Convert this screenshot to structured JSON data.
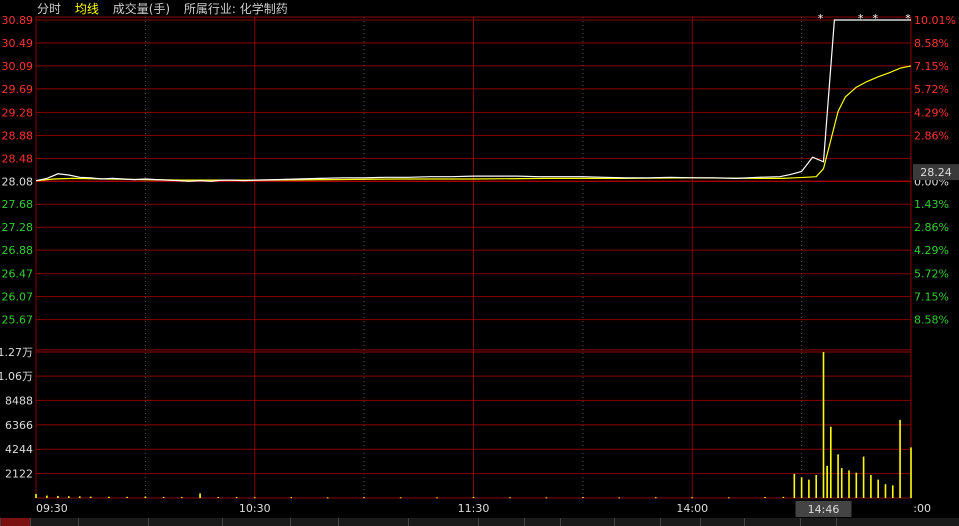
{
  "header": {
    "items": [
      "分时",
      "均线",
      "成交量(手)",
      "所属行业: 化学制药"
    ],
    "colors": [
      "#cccccc",
      "#ffff00",
      "#cccccc",
      "#cccccc"
    ]
  },
  "current_price_label": "28.24",
  "hover_time_label": "14:46",
  "colors": {
    "up": "#ff3232",
    "down": "#33cc33",
    "neutral": "#dddddd",
    "price": "#ffffff",
    "avg": "#ffff00",
    "grid": "#8b0000",
    "volume": "#ffff00"
  },
  "chart_data": [
    {
      "type": "line",
      "title": "",
      "xlabel": "",
      "ylabel": "",
      "prev_close": 28.08,
      "ylim": [
        25.28,
        30.89
      ],
      "left_ticks": [
        "30.89",
        "30.49",
        "30.09",
        "29.69",
        "29.28",
        "28.88",
        "28.48",
        "28.08",
        "27.68",
        "27.28",
        "26.88",
        "26.47",
        "26.07",
        "25.67"
      ],
      "right_ticks": [
        "10.01%",
        "8.58%",
        "7.15%",
        "5.72%",
        "4.29%",
        "2.86%",
        "",
        "0.00%",
        "1.43%",
        "2.86%",
        "4.29%",
        "5.72%",
        "7.15%",
        "8.58%"
      ],
      "x_ticks": [
        "09:30",
        "10:30",
        "11:30",
        "14:00",
        ":00"
      ],
      "series": [
        {
          "x": [
            0,
            3,
            6,
            9,
            12,
            15,
            18,
            21,
            24,
            27,
            30,
            33,
            36,
            39,
            42,
            45,
            48,
            51,
            54,
            57,
            60,
            66,
            72,
            78,
            84,
            90,
            96,
            102,
            108,
            114,
            120,
            126,
            132,
            138,
            144,
            150,
            156,
            162,
            168,
            174,
            180,
            186,
            192,
            198,
            204,
            207,
            210,
            213,
            216,
            219,
            222,
            225,
            228,
            231,
            234,
            237,
            240
          ],
          "values": [
            28.09,
            28.13,
            28.21,
            28.19,
            28.15,
            28.14,
            28.12,
            28.13,
            28.12,
            28.11,
            28.12,
            28.11,
            28.1,
            28.09,
            28.08,
            28.09,
            28.08,
            28.1,
            28.1,
            28.09,
            28.1,
            28.11,
            28.12,
            28.13,
            28.14,
            28.14,
            28.15,
            28.15,
            28.16,
            28.16,
            28.17,
            28.17,
            28.17,
            28.16,
            28.16,
            28.16,
            28.15,
            28.14,
            28.14,
            28.15,
            28.14,
            28.14,
            28.13,
            28.15,
            28.16,
            28.2,
            28.25,
            28.5,
            28.42,
            30.89,
            30.89,
            30.89,
            30.89,
            30.89,
            30.89,
            30.89,
            30.89
          ]
        },
        {
          "x": [
            0,
            5,
            10,
            20,
            30,
            40,
            50,
            60,
            80,
            100,
            120,
            140,
            160,
            180,
            200,
            205,
            208,
            211,
            214,
            216,
            218,
            220,
            222,
            225,
            228,
            231,
            234,
            237,
            240
          ],
          "values": [
            28.09,
            28.12,
            28.13,
            28.12,
            28.11,
            28.1,
            28.1,
            28.1,
            28.11,
            28.12,
            28.12,
            28.13,
            28.13,
            28.14,
            28.13,
            28.13,
            28.14,
            28.15,
            28.16,
            28.3,
            28.8,
            29.3,
            29.55,
            29.72,
            29.82,
            29.9,
            29.97,
            30.05,
            30.09
          ]
        }
      ]
    },
    {
      "type": "bar",
      "title": "",
      "ylim": [
        0,
        12700
      ],
      "left_ticks": [
        "1.27万",
        "1.06万",
        "8488",
        "6366",
        "4244",
        "2122"
      ],
      "bars": [
        {
          "x": 0,
          "v": 350
        },
        {
          "x": 3,
          "v": 210
        },
        {
          "x": 6,
          "v": 180
        },
        {
          "x": 9,
          "v": 150
        },
        {
          "x": 12,
          "v": 140
        },
        {
          "x": 15,
          "v": 120
        },
        {
          "x": 20,
          "v": 110
        },
        {
          "x": 25,
          "v": 100
        },
        {
          "x": 30,
          "v": 130
        },
        {
          "x": 35,
          "v": 90
        },
        {
          "x": 40,
          "v": 80
        },
        {
          "x": 45,
          "v": 400
        },
        {
          "x": 50,
          "v": 90
        },
        {
          "x": 55,
          "v": 80
        },
        {
          "x": 60,
          "v": 70
        },
        {
          "x": 70,
          "v": 75
        },
        {
          "x": 80,
          "v": 60
        },
        {
          "x": 90,
          "v": 70
        },
        {
          "x": 100,
          "v": 65
        },
        {
          "x": 110,
          "v": 60
        },
        {
          "x": 120,
          "v": 90
        },
        {
          "x": 130,
          "v": 70
        },
        {
          "x": 140,
          "v": 60
        },
        {
          "x": 150,
          "v": 75
        },
        {
          "x": 160,
          "v": 60
        },
        {
          "x": 170,
          "v": 70
        },
        {
          "x": 180,
          "v": 65
        },
        {
          "x": 190,
          "v": 60
        },
        {
          "x": 200,
          "v": 80
        },
        {
          "x": 205,
          "v": 100
        },
        {
          "x": 208,
          "v": 2100
        },
        {
          "x": 210,
          "v": 1800
        },
        {
          "x": 212,
          "v": 1600
        },
        {
          "x": 214,
          "v": 2000
        },
        {
          "x": 216,
          "v": 12700
        },
        {
          "x": 217,
          "v": 2800
        },
        {
          "x": 218,
          "v": 6200
        },
        {
          "x": 220,
          "v": 3800
        },
        {
          "x": 221,
          "v": 2600
        },
        {
          "x": 223,
          "v": 2400
        },
        {
          "x": 225,
          "v": 2200
        },
        {
          "x": 227,
          "v": 3600
        },
        {
          "x": 229,
          "v": 2000
        },
        {
          "x": 231,
          "v": 1600
        },
        {
          "x": 233,
          "v": 1200
        },
        {
          "x": 235,
          "v": 1100
        },
        {
          "x": 237,
          "v": 6800
        },
        {
          "x": 240,
          "v": 4400
        }
      ]
    }
  ],
  "bottom_tabs": [
    "",
    "",
    "",
    "",
    "",
    "",
    "",
    "",
    "",
    "",
    "",
    "",
    "",
    "",
    "",
    ""
  ]
}
